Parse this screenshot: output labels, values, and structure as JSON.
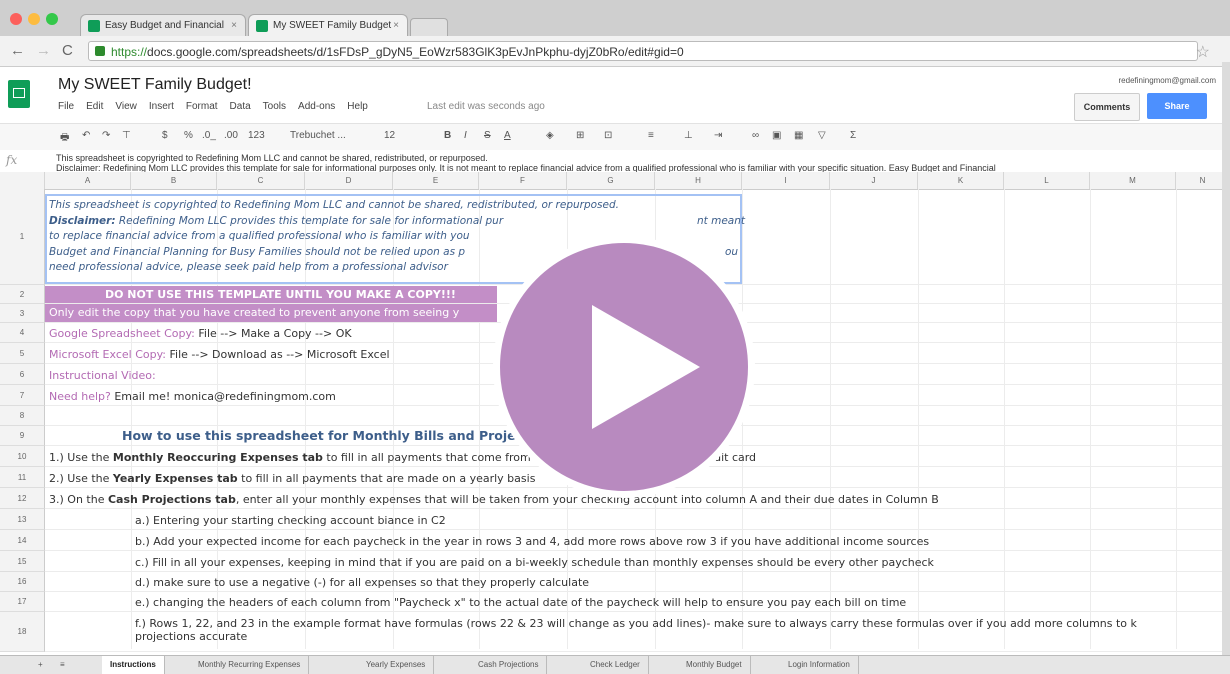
{
  "browser": {
    "tabs": [
      {
        "title": "Easy Budget and Financial"
      },
      {
        "title": "My SWEET Family Budget"
      }
    ],
    "url": {
      "scheme": "https://",
      "rest": "docs.google.com/spreadsheets/d/1sFDsP_gDyN5_EoWzr583GlK3pEvJnPkphu-dyjZ0bRo/edit#gid=0"
    }
  },
  "sheets": {
    "title": "My SWEET Family Budget!",
    "menu": [
      "File",
      "Edit",
      "View",
      "Insert",
      "Format",
      "Data",
      "Tools",
      "Add-ons",
      "Help"
    ],
    "last_edit": "Last edit was seconds ago",
    "account": "redefiningmom@gmail.com",
    "comments_label": "Comments",
    "share_label": "Share",
    "toolbar": {
      "font": "Trebuchet ...",
      "size": "12",
      "format": "123",
      "percent": "%",
      "currency": "$",
      "dec1": ".0_",
      "dec2": ".00"
    }
  },
  "formula_bar": {
    "label": "fx",
    "text": "This spreadsheet is copyrighted to Redefining Mom LLC and cannot be shared, redistributed, or repurposed.",
    "text2": "Disclaimer: Redefining Mom LLC provides this template for sale for informational purposes only. It is not meant to replace financial advice from a qualified professional who is familiar with your specific situation. Easy Budget and Financial"
  },
  "columns": [
    "A",
    "B",
    "C",
    "D",
    "E",
    "F",
    "G",
    "H",
    "I",
    "J",
    "K",
    "L",
    "M",
    "N"
  ],
  "rows": [
    "1",
    "2",
    "3",
    "4",
    "5",
    "6",
    "7",
    "8",
    "9",
    "10",
    "11",
    "12",
    "13",
    "14",
    "15",
    "16",
    "17",
    "18"
  ],
  "cells": {
    "r1_line1": "This spreadsheet is copyrighted to Redefining Mom LLC and cannot be shared, redistributed, or repurposed.",
    "r1_disclaimer_label": "Disclaimer:",
    "r1_line2": " Redefining Mom LLC provides this template for sale for informational pur",
    "r1_line2_end": "nt meant",
    "r1_line3": "to replace financial advice from a qualified professional who is familiar with you",
    "r1_line4": "Budget and Financial Planning for Busy Families should not be relied upon as p",
    "r1_line4_end": "ou",
    "r1_line5": "need professional advice, please seek paid help from a professional advisor",
    "r2": "DO NOT USE THIS TEMPLATE UNTIL YOU MAKE A COPY!!!",
    "r3": "Only edit the copy that you have created to prevent anyone from seeing y",
    "r4_label": "Google Spreadsheet Copy:",
    "r4_value": " File --> Make a Copy --> OK",
    "r5_label": "Microsoft Excel Copy:",
    "r5_value": " File --> Download as --> Microsoft Excel",
    "r6": "Instructional Video:",
    "r7_label": "Need help?",
    "r7_value": " Email me! monica@redefiningmom.com",
    "r9": "How to use this spreadsheet for Monthly Bills and Proje",
    "r10_a": "1.) Use the ",
    "r10_b": "Monthly Reoccuring Expenses tab",
    "r10_c": " to fill in all payments that come from",
    "r10_d": "credit card",
    "r11_a": "2.) Use the ",
    "r11_b": "Yearly Expenses tab",
    "r11_c": " to fill in all payments that are made on a yearly basis",
    "r12_a": "3.) On the ",
    "r12_b": "Cash Projections tab",
    "r12_c": ", enter all your monthly expenses that will be taken from your checking account into column A and their due dates in Column B",
    "r13": "a.) Entering your starting checking account biance in C2",
    "r14": "b.) Add your expected income for each paycheck in the year in rows 3 and 4, add more rows above row 3 if you have additional income sources",
    "r15": "c.) Fill in all your expenses, keeping in mind that if you are paid on a bi-weekly schedule than monthly expenses should be every other paycheck",
    "r16": "d.) make sure to use a negative (-) for all expenses so that they properly calculate",
    "r17": "e.) changing the headers of each column from \"Paycheck x\" to the actual date of the paycheck will help to ensure you pay each bill on time",
    "r18_line1": "f.) Rows 1, 22, and 23 in the example format have formulas (rows 22 & 23 will change as you add lines)- make sure to always carry these formulas over if you add more columns to k",
    "r18_line2": "projections accurate"
  },
  "sheet_tabs": [
    "Instructions",
    "Monthly Recurring Expenses",
    "Yearly Expenses",
    "Cash Projections",
    "Check Ledger",
    "Monthly Budget",
    "Login Information"
  ],
  "colors": {
    "purple": "#c38ec7",
    "play": "#b88abf",
    "blue_text": "#3d5e8a",
    "share": "#4d90fe",
    "sheets_green": "#0f9d58"
  }
}
